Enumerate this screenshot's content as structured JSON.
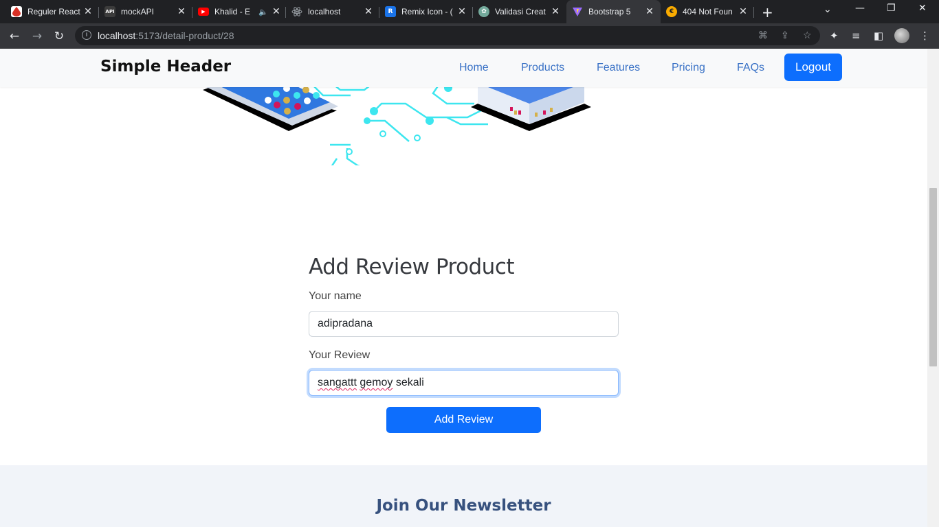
{
  "browser": {
    "tabs": [
      {
        "title": "Reguler React",
        "favicon": "drop-icon",
        "color": "#d93025"
      },
      {
        "title": "mockAPI",
        "favicon": "api-icon",
        "color": "#3c3c3c"
      },
      {
        "title": "Khalid - E",
        "favicon": "youtube-icon",
        "color": "#ff0000",
        "audio": true
      },
      {
        "title": "localhost",
        "favicon": "react-icon",
        "color": "#5f6368"
      },
      {
        "title": "Remix Icon - (",
        "favicon": "remix-icon",
        "color": "#1a73e8"
      },
      {
        "title": "Validasi Creat",
        "favicon": "openai-icon",
        "color": "#74aa9c"
      },
      {
        "title": "Bootstrap 5",
        "favicon": "vite-icon",
        "color": "#9b6cff",
        "active": true
      },
      {
        "title": "404 Not Foun",
        "favicon": "euro-icon",
        "color": "#f9ab00"
      }
    ],
    "url_host": "localhost",
    "url_path": ":5173/detail-product/28"
  },
  "header": {
    "brand": "Simple Header",
    "nav": [
      "Home",
      "Products",
      "Features",
      "Pricing",
      "FAQs"
    ],
    "logout_label": "Logout",
    "accent": "#0d6efd"
  },
  "review_form": {
    "title": "Add Review Product",
    "name_label": "Your name",
    "name_value": "adipradana",
    "review_label": "Your Review",
    "review_value_parts": [
      "sangattt",
      "gemoy",
      "sekali"
    ],
    "submit_label": "Add Review"
  },
  "newsletter": {
    "title": "Join Our Newsletter"
  }
}
